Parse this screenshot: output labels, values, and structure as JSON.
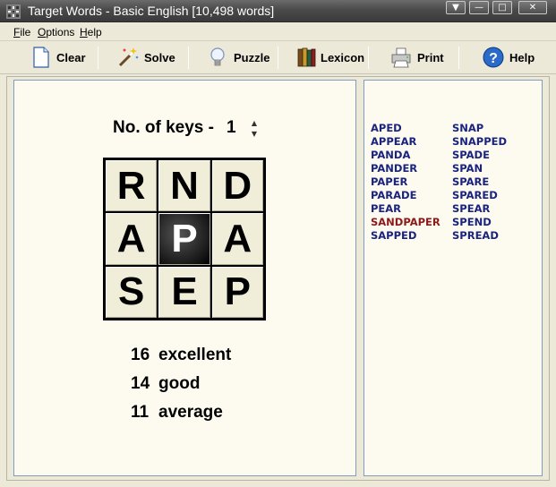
{
  "window": {
    "title": "Target Words - Basic English [10,498 words]"
  },
  "menu": [
    {
      "label": "File",
      "accel": "F",
      "rest": "ile"
    },
    {
      "label": "Options",
      "accel": "O",
      "rest": "ptions"
    },
    {
      "label": "Help",
      "accel": "H",
      "rest": "elp"
    }
  ],
  "toolbar": {
    "clear": "Clear",
    "solve": "Solve",
    "puzzle": "Puzzle",
    "lexicon": "Lexicon",
    "print": "Print",
    "help": "Help"
  },
  "keys": {
    "label": "No. of keys -",
    "value": "1"
  },
  "grid": {
    "letters": [
      "R",
      "N",
      "D",
      "A",
      "P",
      "A",
      "S",
      "E",
      "P"
    ],
    "key_index": 4
  },
  "scores": [
    {
      "value": "16",
      "label": "excellent"
    },
    {
      "value": "14",
      "label": "good"
    },
    {
      "value": "11",
      "label": "average"
    }
  ],
  "words": {
    "col1": [
      "APED",
      "APPEAR",
      "PANDA",
      "PANDER",
      "PAPER",
      "PARADE",
      "PEAR",
      "SANDPAPER",
      "SAPPED"
    ],
    "col2": [
      "SNAP",
      "SNAPPED",
      "SPADE",
      "SPAN",
      "SPARE",
      "SPARED",
      "SPEAR",
      "SPEND",
      "SPREAD"
    ],
    "target_word": "SANDPAPER"
  },
  "colors": {
    "word": "#1a237e",
    "target_word": "#8b1a1a",
    "panel_bg": "#fdfbf0"
  }
}
